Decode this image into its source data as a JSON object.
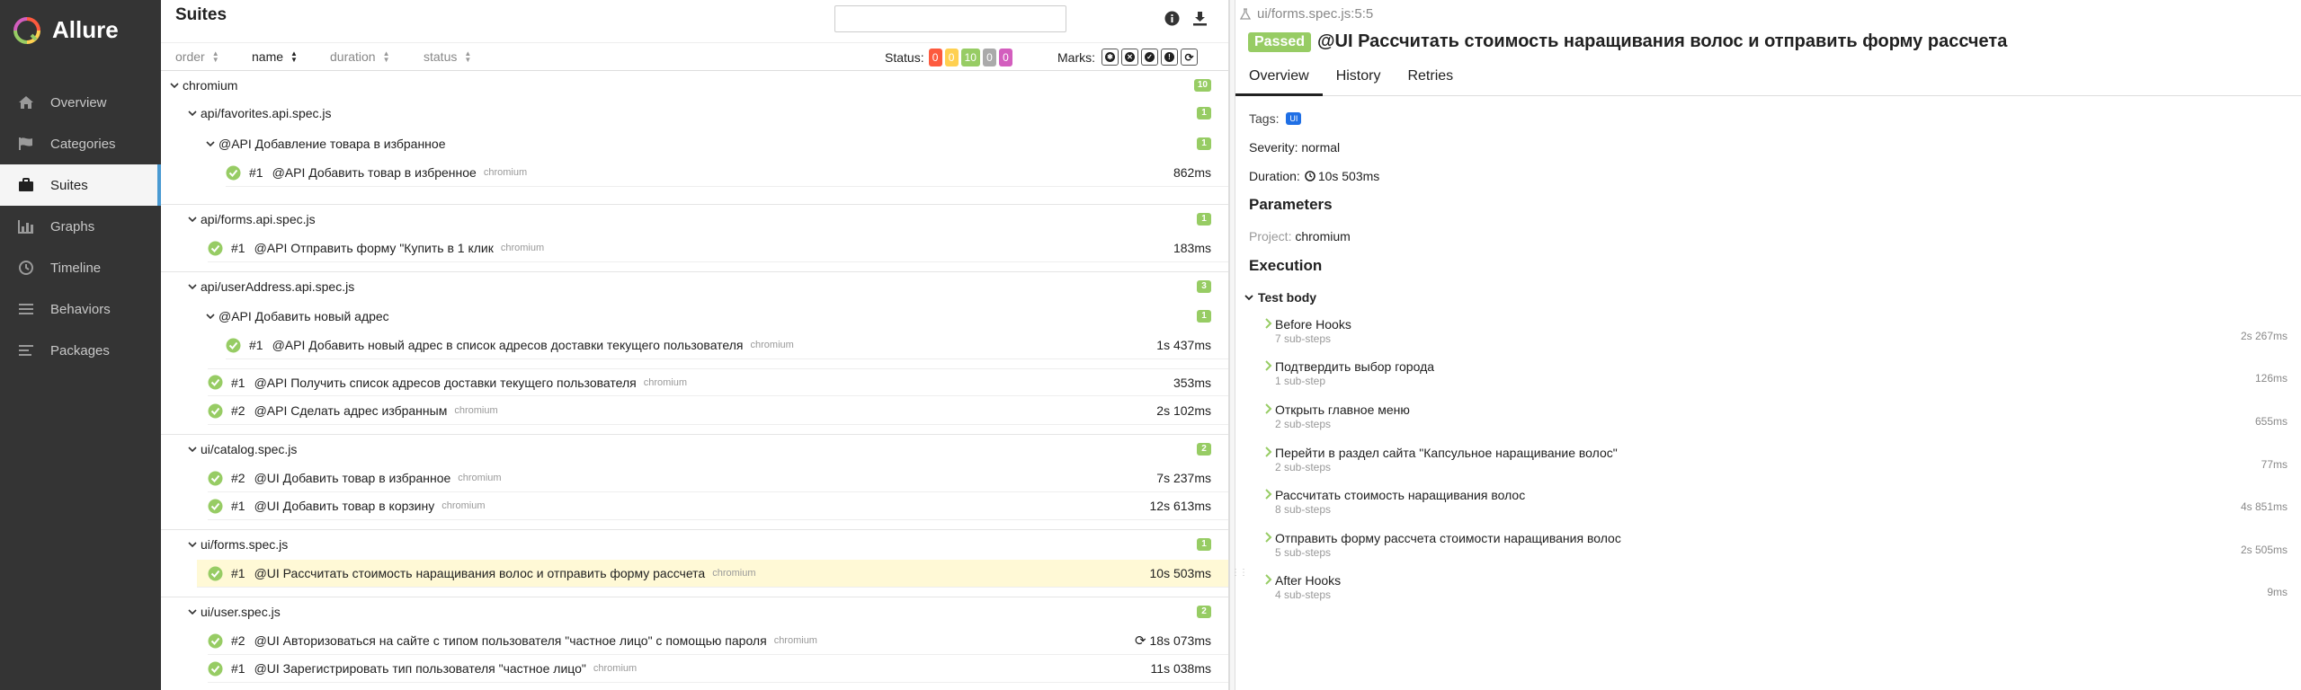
{
  "app": {
    "name": "Allure"
  },
  "sidebar": {
    "items": [
      {
        "label": "Overview",
        "icon": "home-icon"
      },
      {
        "label": "Categories",
        "icon": "flag-icon"
      },
      {
        "label": "Suites",
        "icon": "briefcase-icon",
        "active": true
      },
      {
        "label": "Graphs",
        "icon": "bar-chart-icon"
      },
      {
        "label": "Timeline",
        "icon": "clock-icon"
      },
      {
        "label": "Behaviors",
        "icon": "list-icon"
      },
      {
        "label": "Packages",
        "icon": "align-left-icon"
      }
    ]
  },
  "middle": {
    "title": "Suites",
    "search": {
      "placeholder": "",
      "value": ""
    },
    "sort": [
      "order",
      "name",
      "duration",
      "status"
    ],
    "status_label": "Status:",
    "status_counts": [
      {
        "value": "0",
        "color": "#fd5a3e"
      },
      {
        "value": "0",
        "color": "#ffd050"
      },
      {
        "value": "10",
        "color": "#97cc64"
      },
      {
        "value": "0",
        "color": "#aaaaaa"
      },
      {
        "value": "0",
        "color": "#d35ebe"
      }
    ],
    "marks_label": "Marks:",
    "tree": {
      "root": {
        "label": "chromium",
        "count": "10"
      },
      "groups": [
        {
          "label": "api/favorites.api.spec.js",
          "count": "1",
          "sub": {
            "label": "@API Добавление товара в избранное",
            "count": "1"
          },
          "leaves": [
            {
              "num": "#1",
              "name": "@API Добавить товар в избренное",
              "env": "chromium",
              "duration": "862ms"
            }
          ]
        },
        {
          "label": "api/forms.api.spec.js",
          "count": "1",
          "leaves": [
            {
              "num": "#1",
              "name": "@API Отправить форму \"Купить в 1 клик",
              "env": "chromium",
              "duration": "183ms"
            }
          ]
        },
        {
          "label": "api/userAddress.api.spec.js",
          "count": "3",
          "sub": {
            "label": "@API Добавить новый адрес",
            "count": "1"
          },
          "sub_leaves": [
            {
              "num": "#1",
              "name": "@API Добавить новый адрес в список адресов доставки текущего пользователя",
              "env": "chromium",
              "duration": "1s 437ms"
            }
          ],
          "leaves": [
            {
              "num": "#1",
              "name": "@API Получить список адресов доставки текущего пользователя",
              "env": "chromium",
              "duration": "353ms"
            },
            {
              "num": "#2",
              "name": "@API Сделать адрес избранным",
              "env": "chromium",
              "duration": "2s 102ms"
            }
          ]
        },
        {
          "label": "ui/catalog.spec.js",
          "count": "2",
          "leaves": [
            {
              "num": "#2",
              "name": "@UI Добавить товар в избранное",
              "env": "chromium",
              "duration": "7s 237ms"
            },
            {
              "num": "#1",
              "name": "@UI Добавить товар в корзину",
              "env": "chromium",
              "duration": "12s 613ms"
            }
          ]
        },
        {
          "label": "ui/forms.spec.js",
          "count": "1",
          "leaves": [
            {
              "num": "#1",
              "name": "@UI Рассчитать стоимость наращивания волос и отправить форму рассчета",
              "env": "chromium",
              "duration": "10s 503ms",
              "selected": true
            }
          ]
        },
        {
          "label": "ui/user.spec.js",
          "count": "2",
          "leaves": [
            {
              "num": "#2",
              "name": "@UI Авторизоваться на сайте с типом пользователя \"частное лицо\" с помощью пароля",
              "env": "chromium",
              "duration": "18s 073ms",
              "retried": true
            },
            {
              "num": "#1",
              "name": "@UI Зарегистрировать тип пользователя \"частное лицо\"",
              "env": "chromium",
              "duration": "11s 038ms"
            }
          ]
        }
      ]
    }
  },
  "detail": {
    "breadcrumb": "ui/forms.spec.js:5:5",
    "status": "Passed",
    "title": "@UI Рассчитать стоимость наращивания волос и отправить форму рассчета",
    "tabs": [
      "Overview",
      "History",
      "Retries"
    ],
    "tags_label": "Tags:",
    "tag": "UI",
    "severity": "Severity: normal",
    "duration_label": "Duration:",
    "duration": "10s 503ms",
    "parameters_heading": "Parameters",
    "param_name": "Project:",
    "param_value": "chromium",
    "execution_heading": "Execution",
    "test_body": "Test body",
    "steps": [
      {
        "name": "Before Hooks",
        "sub": "7 sub-steps",
        "time": "2s 267ms"
      },
      {
        "name": "Подтвердить выбор города",
        "sub": "1 sub-step",
        "time": "126ms"
      },
      {
        "name": "Открыть главное меню",
        "sub": "2 sub-steps",
        "time": "655ms"
      },
      {
        "name": "Перейти в раздел сайта \"Капсульное наращивание волос\"",
        "sub": "2 sub-steps",
        "time": "77ms"
      },
      {
        "name": "Рассчитать стоимость наращивания волос",
        "sub": "8 sub-steps",
        "time": "4s 851ms"
      },
      {
        "name": "Отправить форму рассчета стоимости наращивания волос",
        "sub": "5 sub-steps",
        "time": "2s 505ms"
      },
      {
        "name": "After Hooks",
        "sub": "4 sub-steps",
        "time": "9ms"
      }
    ]
  }
}
